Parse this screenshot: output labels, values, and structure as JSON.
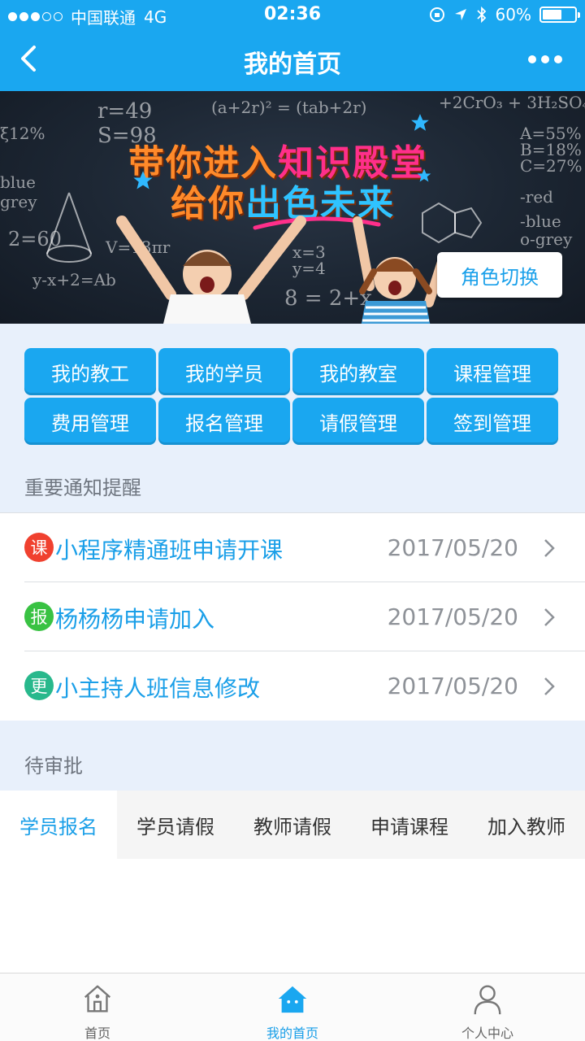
{
  "status_bar": {
    "carrier": "中国联通",
    "network": "4G",
    "time": "02:36",
    "battery": "60%",
    "battery_level": 0.6
  },
  "nav": {
    "title": "我的首页",
    "back_icon": "chevron-left-icon",
    "more_icon": "more-dots-icon"
  },
  "banner": {
    "line1_a": "带你进入",
    "line1_b": "知识殿堂",
    "line2_a": "给你",
    "line2_b": "出色未来",
    "role_switch": "角色切换"
  },
  "quick_actions": [
    {
      "label": "我的教工"
    },
    {
      "label": "我的学员"
    },
    {
      "label": "我的教室"
    },
    {
      "label": "课程管理"
    },
    {
      "label": "费用管理"
    },
    {
      "label": "报名管理"
    },
    {
      "label": "请假管理"
    },
    {
      "label": "签到管理"
    }
  ],
  "notices": {
    "title": "重要通知提醒",
    "items": [
      {
        "badge": "课",
        "badge_color": "#f0412f",
        "text": "小程序精通班申请开课",
        "date": "2017/05/20"
      },
      {
        "badge": "报",
        "badge_color": "#39c243",
        "text": "杨杨杨申请加入",
        "date": "2017/05/20"
      },
      {
        "badge": "更",
        "badge_color": "#28b88c",
        "text": "小主持人班信息修改",
        "date": "2017/05/20"
      }
    ]
  },
  "pending": {
    "title": "待审批",
    "tabs": [
      {
        "label": "学员报名"
      },
      {
        "label": "学员请假"
      },
      {
        "label": "教师请假"
      },
      {
        "label": "申请课程"
      },
      {
        "label": "加入教师"
      }
    ],
    "active_tab": 0
  },
  "bottom_nav": [
    {
      "label": "首页",
      "icon": "home-outline-icon"
    },
    {
      "label": "我的首页",
      "icon": "home-smile-icon"
    },
    {
      "label": "个人中心",
      "icon": "user-icon"
    }
  ],
  "colors": {
    "primary": "#1aa7f0",
    "accent_text": "#1a9fe8",
    "section_bg": "#e8f0fb"
  }
}
